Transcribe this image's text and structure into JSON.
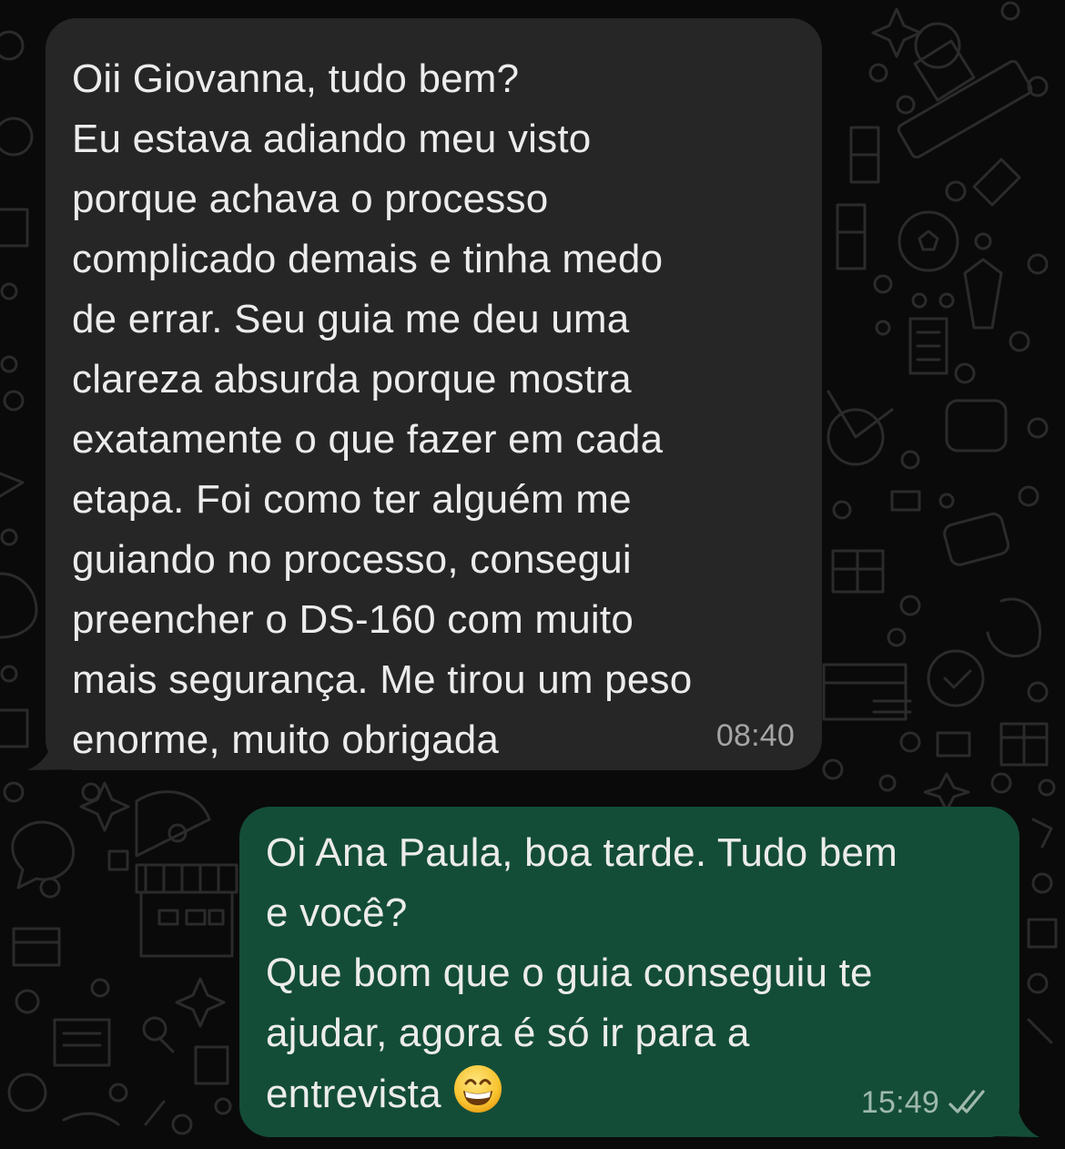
{
  "chat": {
    "messages": [
      {
        "direction": "incoming",
        "text": "Oii Giovanna, tudo bem?\nEu estava adiando meu visto\nporque achava o processo\ncomplicado demais e tinha medo\nde errar. Seu guia me deu uma\nclareza absurda porque mostra\nexatamente o que fazer em cada\netapa. Foi como ter alguém me\nguiando no processo, consegui\npreencher o DS-160 com muito\nmais segurança. Me tirou um peso\nenorme, muito obrigada",
        "time": "08:40"
      },
      {
        "direction": "outgoing",
        "text": "Oi Ana Paula, boa tarde. Tudo bem\ne você?\nQue bom que o guia conseguiu te\najudar, agora é só ir para a\nentrevista ",
        "emoji": "grinning-face-with-smiling-eyes",
        "time": "15:49",
        "status": "read-double-check"
      }
    ]
  },
  "colors": {
    "background": "#0a0a0a",
    "incoming_bubble": "#262626",
    "outgoing_bubble": "#144d37",
    "text": "#ececec",
    "timestamp": "#a5a5a5"
  }
}
